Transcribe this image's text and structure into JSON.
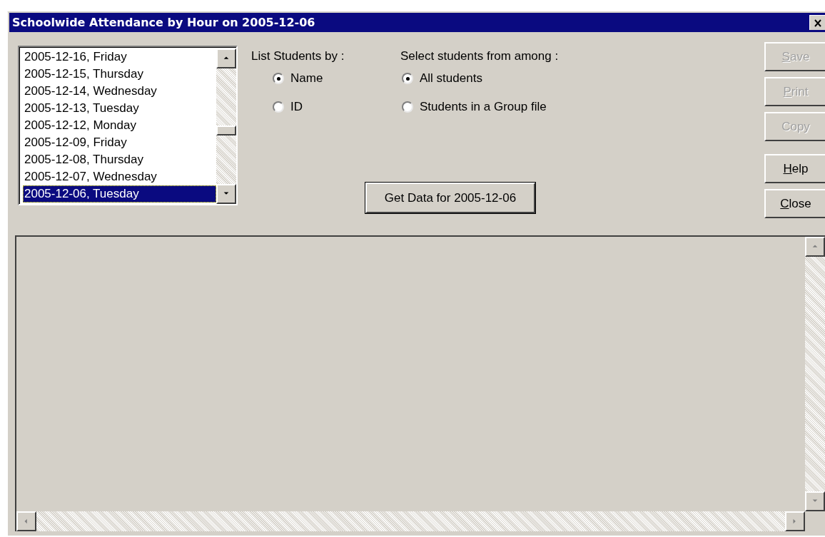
{
  "window": {
    "title": "Schoolwide Attendance by Hour on 2005-12-06"
  },
  "date_list": {
    "items": [
      {
        "label": "2005-12-16, Friday",
        "selected": false
      },
      {
        "label": "2005-12-15, Thursday",
        "selected": false
      },
      {
        "label": "2005-12-14, Wednesday",
        "selected": false
      },
      {
        "label": "2005-12-13, Tuesday",
        "selected": false
      },
      {
        "label": "2005-12-12, Monday",
        "selected": false
      },
      {
        "label": "2005-12-09, Friday",
        "selected": false
      },
      {
        "label": "2005-12-08, Thursday",
        "selected": false
      },
      {
        "label": "2005-12-07, Wednesday",
        "selected": false
      },
      {
        "label": "2005-12-06, Tuesday",
        "selected": true
      }
    ]
  },
  "option_groups": [
    {
      "label": "List Students by :",
      "options": [
        {
          "label": "Name",
          "selected": true
        },
        {
          "label": "ID",
          "selected": false
        }
      ]
    },
    {
      "label": "Select students from among :",
      "options": [
        {
          "label": "All students",
          "selected": true
        },
        {
          "label": "Students in a Group file",
          "selected": false
        }
      ]
    }
  ],
  "get_data_button": {
    "label": "Get Data for 2005-12-06"
  },
  "buttons": [
    {
      "label": "Save",
      "first_letter_underlined": true,
      "disabled": true
    },
    {
      "label": "Print",
      "first_letter_underlined": true,
      "disabled": true
    },
    {
      "label": "Copy",
      "first_letter_underlined": false,
      "disabled": true
    },
    {
      "label": "Help",
      "first_letter_underlined": true,
      "disabled": false
    },
    {
      "label": "Close",
      "first_letter_underlined": true,
      "disabled": false
    }
  ]
}
